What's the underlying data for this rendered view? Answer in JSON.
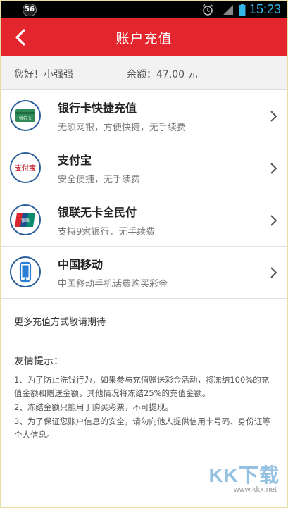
{
  "status_bar": {
    "notification_count": "56",
    "time": "15:23",
    "icons": [
      "alarm-icon",
      "signal-icon",
      "battery-icon"
    ],
    "time_color": "#33b5e5"
  },
  "header": {
    "title": "账户充值",
    "back_icon": "chevron-left-icon",
    "color": "#e3262d"
  },
  "account": {
    "greeting": "您好！小强强",
    "balance": "余额：47.00 元"
  },
  "payment_methods": [
    {
      "title": "银行卡快捷充值",
      "subtitle": "无须网银，方便快捷，无手续费",
      "icon": "bank-card-icon",
      "icon_text": "银行卡"
    },
    {
      "title": "支付宝",
      "subtitle": "安全便捷，无手续费",
      "icon": "alipay-icon",
      "icon_text": "支付宝"
    },
    {
      "title": "银联无卡全民付",
      "subtitle": "支持9家银行，无手续费",
      "icon": "unionpay-icon",
      "icon_text": "银联"
    },
    {
      "title": "中国移动",
      "subtitle": "中国移动手机话费购买彩金",
      "icon": "mobile-phone-icon"
    }
  ],
  "more_text": "更多充值方式敬请期待",
  "tips": {
    "title": "友情提示：",
    "items": [
      "1、为了防止洗钱行为，如果参与充值赠送彩金活动，将冻结100%的充值金额和赠送金额，其他情况将冻结25%的充值金额。",
      "2、冻结金额只能用于购买彩票，不可提现。",
      "3、为了保证您账户信息的安全，请勿向他人提供信用卡号码、身份证等个人信息。"
    ]
  },
  "watermark": {
    "brand": "KK下载",
    "url": "www.kkx.net"
  }
}
